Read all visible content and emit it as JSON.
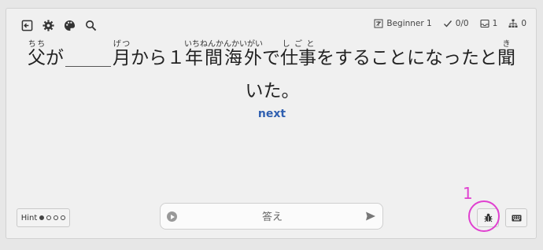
{
  "toolbar": {
    "icons": [
      "exit-icon",
      "gear-icon",
      "palette-icon",
      "search-icon"
    ],
    "level": "Beginner 1",
    "score": "0/0",
    "inbox": "1",
    "stack": "0"
  },
  "sentence": {
    "p1": "父",
    "p1_ruby": "ちち",
    "p2": "が",
    "p3": "月",
    "p3_ruby": "げつ",
    "p4": "から１",
    "p5": "年間海外",
    "p5_ruby": "いちねんかんかいがい",
    "p6": "で",
    "p7": "仕事",
    "p7_ruby": "しごと",
    "p8": "をすることになったと",
    "p9": "聞",
    "p9_ruby": "き",
    "p10": "いた。"
  },
  "next_label": "next",
  "hint": {
    "label": "Hint",
    "dots": [
      true,
      false,
      false,
      false
    ]
  },
  "answer": {
    "placeholder": "答え",
    "value": ""
  },
  "annotation": {
    "number": "1",
    "color": "#e040d0"
  },
  "colors": {
    "next": "#2f5fb0",
    "annotation": "#e040d0"
  }
}
